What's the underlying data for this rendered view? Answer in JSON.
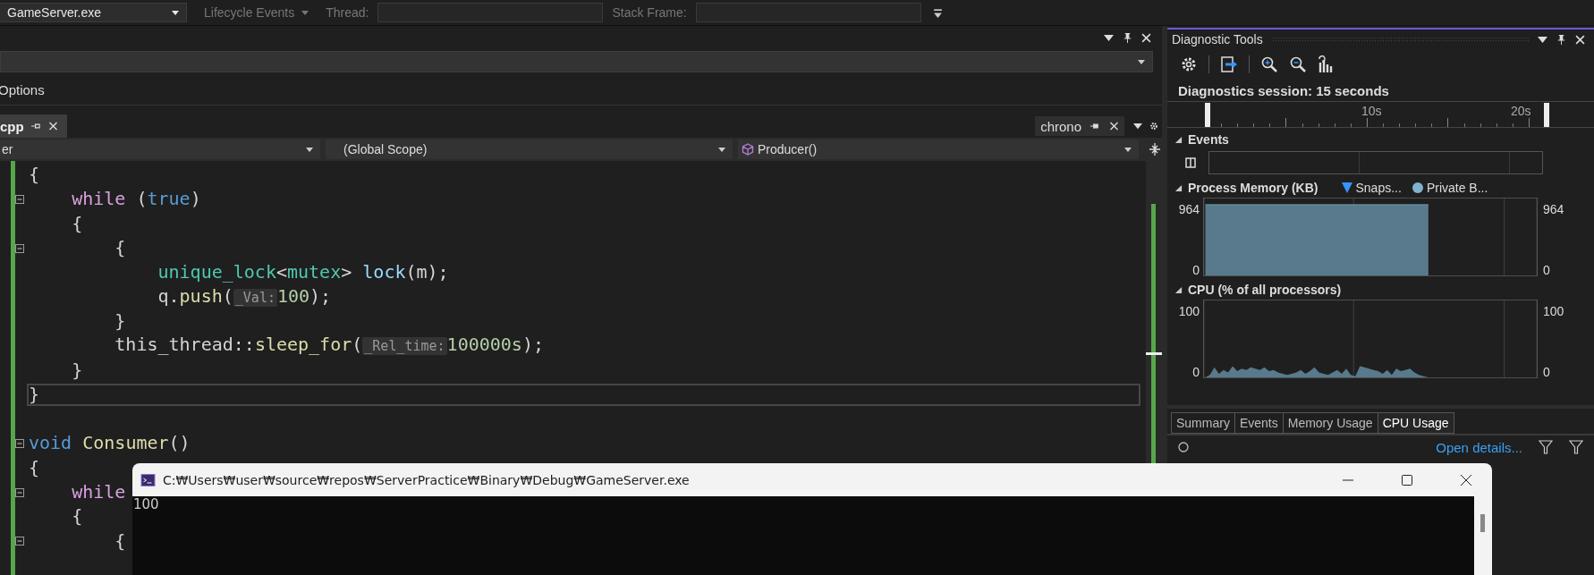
{
  "toolbar": {
    "items": [
      {
        "kind": "dropdown",
        "text": "GameServer.exe",
        "disabled": false
      },
      {
        "kind": "dropdown",
        "text": "Lifecycle Events",
        "disabled": true
      },
      {
        "kind": "label",
        "text": "Thread:",
        "disabled": true
      },
      {
        "kind": "field",
        "disabled": true
      },
      {
        "kind": "label",
        "text": "Stack Frame:",
        "disabled": true
      },
      {
        "kind": "field",
        "disabled": true
      }
    ]
  },
  "left_panel": {
    "options_label": "Options",
    "file_tabs": [
      {
        "label": "cpp",
        "selected": true
      }
    ],
    "preview_tab": {
      "label": "chrono"
    },
    "nav": {
      "project": "er",
      "scope": "(Global Scope)",
      "member": "Producer()"
    }
  },
  "code_lines": [
    {
      "collapsible": false,
      "current": false,
      "tokens": [
        {
          "kind": "plain",
          "text": "{"
        }
      ]
    },
    {
      "collapsible": true,
      "current": false,
      "tokens": [
        {
          "kind": "control",
          "text": "    while"
        },
        {
          "kind": "plain",
          "text": " ("
        },
        {
          "kind": "keyword",
          "text": "true"
        },
        {
          "kind": "plain",
          "text": ")"
        }
      ]
    },
    {
      "collapsible": false,
      "current": false,
      "tokens": [
        {
          "kind": "plain",
          "text": "    {"
        }
      ]
    },
    {
      "collapsible": true,
      "current": false,
      "tokens": [
        {
          "kind": "plain",
          "text": "        {"
        }
      ]
    },
    {
      "collapsible": false,
      "current": false,
      "tokens": [
        {
          "kind": "type",
          "text": "            unique_lock"
        },
        {
          "kind": "plain",
          "text": "<"
        },
        {
          "kind": "type",
          "text": "mutex"
        },
        {
          "kind": "plain",
          "text": "> "
        },
        {
          "kind": "variable",
          "text": "lock"
        },
        {
          "kind": "plain",
          "text": "(m);"
        }
      ]
    },
    {
      "collapsible": false,
      "current": false,
      "tokens": [
        {
          "kind": "plain",
          "text": "            q."
        },
        {
          "kind": "function",
          "text": "push"
        },
        {
          "kind": "plain",
          "text": "("
        },
        {
          "kind": "hint",
          "text": "_Val:"
        },
        {
          "kind": "number",
          "text": "100"
        },
        {
          "kind": "plain",
          "text": ");"
        }
      ]
    },
    {
      "collapsible": false,
      "current": false,
      "tokens": [
        {
          "kind": "plain",
          "text": "        }"
        }
      ]
    },
    {
      "collapsible": false,
      "current": false,
      "tokens": [
        {
          "kind": "plain",
          "text": "        this_thread::"
        },
        {
          "kind": "function",
          "text": "sleep_for"
        },
        {
          "kind": "plain",
          "text": "("
        },
        {
          "kind": "hint",
          "text": "_Rel_time:"
        },
        {
          "kind": "number",
          "text": "100000s"
        },
        {
          "kind": "plain",
          "text": ");"
        }
      ]
    },
    {
      "collapsible": false,
      "current": false,
      "tokens": [
        {
          "kind": "plain",
          "text": "    }"
        }
      ]
    },
    {
      "collapsible": false,
      "current": true,
      "tokens": [
        {
          "kind": "plain",
          "text": "}"
        }
      ]
    },
    {
      "collapsible": false,
      "current": false
    },
    {
      "collapsible": true,
      "current": false,
      "tokens": [
        {
          "kind": "keyword",
          "text": "void"
        },
        {
          "kind": "function",
          "text": " Consumer"
        },
        {
          "kind": "plain",
          "text": "()"
        }
      ]
    },
    {
      "collapsible": false,
      "current": false,
      "tokens": [
        {
          "kind": "plain",
          "text": "{"
        }
      ]
    },
    {
      "collapsible": true,
      "current": false,
      "tokens": [
        {
          "kind": "control",
          "text": "    while"
        }
      ]
    },
    {
      "collapsible": false,
      "current": false,
      "tokens": [
        {
          "kind": "plain",
          "text": "    {"
        }
      ]
    },
    {
      "collapsible": true,
      "current": false,
      "tokens": [
        {
          "kind": "plain",
          "text": "        {"
        }
      ]
    }
  ],
  "diagnostics": {
    "title": "Diagnostic Tools",
    "session": "Diagnostics session: 15 seconds",
    "timeline_labels": [
      "10s",
      "20s"
    ],
    "events": {
      "title": "Events",
      "expanded": true
    },
    "memory": {
      "title": "Process Memory (KB)",
      "expanded": true,
      "legend": [
        {
          "label": "Snaps...",
          "kind": "triangle",
          "color": "#3794ff"
        },
        {
          "label": "Private B...",
          "kind": "circle",
          "color": "#7fb3cc"
        }
      ],
      "left_axis": [
        "964",
        "0"
      ],
      "right_axis": [
        "964",
        "0"
      ]
    },
    "cpu": {
      "title": "CPU (% of all processors)",
      "expanded": true,
      "left_axis": [
        "100",
        "0"
      ],
      "right_axis": [
        "100",
        "0"
      ]
    },
    "tabs": [
      {
        "label": "Summary",
        "selected": false
      },
      {
        "label": "Events",
        "selected": false
      },
      {
        "label": "Memory Usage",
        "selected": false
      },
      {
        "label": "CPU Usage",
        "selected": true
      }
    ],
    "open_details": "Open details..."
  },
  "console": {
    "title": "C:₩Users₩user₩source₩repos₩ServerPractice₩Binary₩Debug₩GameServer.exe",
    "output": "100"
  }
}
